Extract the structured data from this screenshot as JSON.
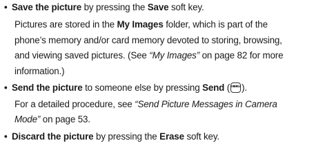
{
  "items": [
    {
      "bullet": "•",
      "lead": "Save the picture",
      "text_a": " by pressing the ",
      "key": "Save",
      "text_b": " soft key.",
      "detail": {
        "line1_a": "Pictures are stored in the ",
        "line1_bold": "My Images",
        "line1_b": " folder, which is part of the",
        "line2": "phone’s memory and/or card memory devoted to storing, browsing,",
        "line3_a": "and viewing saved pictures. (See ",
        "line3_italic": "“My Images”",
        "line3_b": " on page 82 for more",
        "line4": "information.)"
      }
    },
    {
      "bullet": "•",
      "lead": "Send the picture",
      "text_a": " to someone else by pressing ",
      "key": "Send",
      "text_b": " (",
      "icon_top": "MENU",
      "icon_bottom": "OK",
      "text_c": ").",
      "detail": {
        "line1_a": "For a detailed procedure, see ",
        "line1_italic": "“Send Picture Messages in Camera",
        "line2_italic": "Mode”",
        "line2_b": " on page 53."
      }
    },
    {
      "bullet": "•",
      "lead": "Discard the picture",
      "text_a": " by pressing the ",
      "key": "Erase",
      "text_b": " soft key."
    }
  ]
}
